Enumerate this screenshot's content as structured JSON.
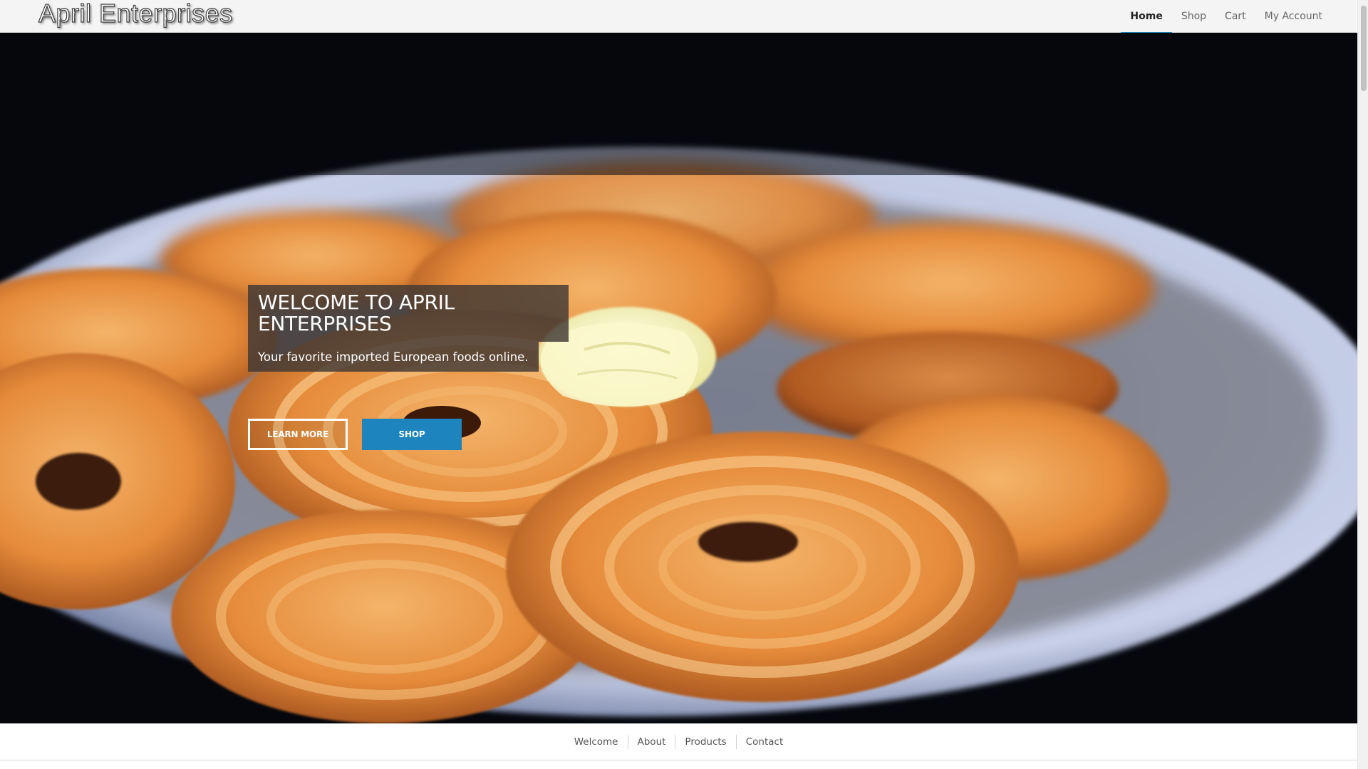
{
  "header": {
    "logo": "April Enterprises",
    "nav": [
      {
        "label": "Home",
        "active": true
      },
      {
        "label": "Shop",
        "active": false
      },
      {
        "label": "Cart",
        "active": false
      },
      {
        "label": "My Account",
        "active": false
      }
    ]
  },
  "hero": {
    "title": "WELCOME TO APRIL ENTERPRISES",
    "subtitle": "Your favorite imported European foods online.",
    "buttons": {
      "learn_more": "LEARN MORE",
      "shop": "SHOP"
    }
  },
  "sub_nav": {
    "items": [
      "Welcome",
      "About",
      "Products",
      "Contact"
    ]
  },
  "colors": {
    "accent": "#1d84bd",
    "header_bg": "#f4f4f4",
    "hero_bg": "#05070d"
  }
}
